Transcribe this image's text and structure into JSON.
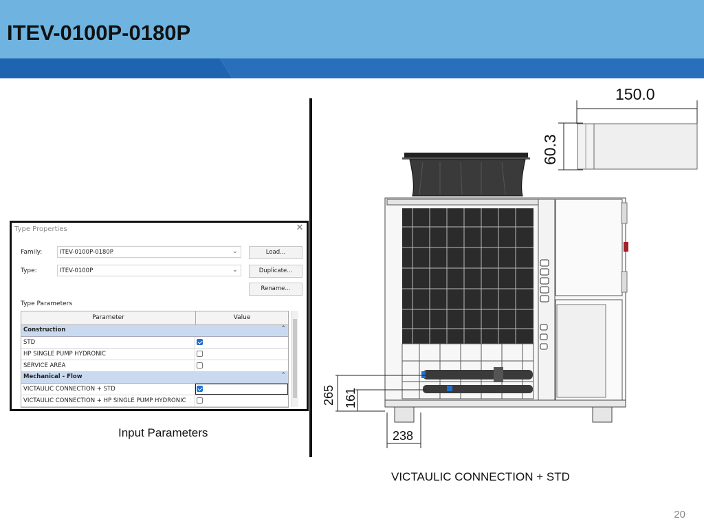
{
  "header": {
    "title": "ITEV-0100P-0180P",
    "colors": {
      "light": "#6fb4e0",
      "dark": "#1f64b0"
    }
  },
  "dialog": {
    "title": "Type Properties",
    "family_label": "Family:",
    "family_value": "ITEV-0100P-0180P",
    "type_label": "Type:",
    "type_value": "ITEV-0100P",
    "load_button": "Load...",
    "duplicate_button": "Duplicate...",
    "rename_button": "Rename...",
    "section_label": "Type Parameters",
    "col_parameter": "Parameter",
    "col_value": "Value",
    "groups": [
      {
        "label": "Construction",
        "rows": [
          {
            "name": "STD",
            "checked": true
          },
          {
            "name": "HP SINGLE PUMP HYDRONIC",
            "checked": false
          },
          {
            "name": "SERVICE AREA",
            "checked": false
          }
        ]
      },
      {
        "label": "Mechanical - Flow",
        "rows": [
          {
            "name": "VICTAULIC CONNECTION + STD",
            "checked": true
          },
          {
            "name": "VICTAULIC CONNECTION + HP SINGLE PUMP HYDRONIC",
            "checked": false
          }
        ]
      }
    ]
  },
  "captions": {
    "left": "Input Parameters",
    "right": "VICTAULIC CONNECTION + STD"
  },
  "drawing": {
    "dim_width": "150.0",
    "dim_pipe_height": "60.3",
    "dim_265": "265",
    "dim_161": "161",
    "dim_238": "238"
  },
  "page_number": "20"
}
